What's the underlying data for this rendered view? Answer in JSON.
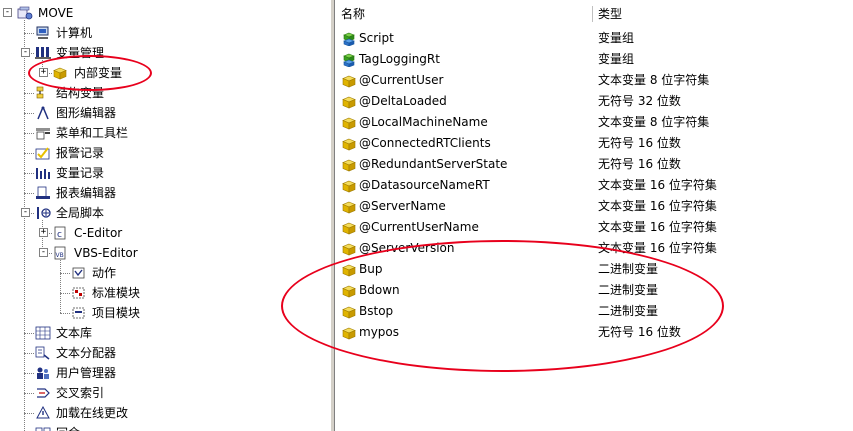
{
  "tree": {
    "items": [
      {
        "label": "MOVE",
        "level": 0,
        "icon": "computer-project-icon",
        "expander": "-"
      },
      {
        "label": "计算机",
        "level": 1,
        "icon": "computer-icon"
      },
      {
        "label": "变量管理",
        "level": 1,
        "icon": "tag-management-icon",
        "expander": "-"
      },
      {
        "label": "内部变量",
        "level": 2,
        "icon": "cube-group-icon",
        "expander": "+"
      },
      {
        "label": "结构变量",
        "level": 1,
        "icon": "structure-icon"
      },
      {
        "label": "图形编辑器",
        "level": 1,
        "icon": "graphics-editor-icon"
      },
      {
        "label": "菜单和工具栏",
        "level": 1,
        "icon": "menu-toolbar-icon"
      },
      {
        "label": "报警记录",
        "level": 1,
        "icon": "alarm-logging-icon"
      },
      {
        "label": "变量记录",
        "level": 1,
        "icon": "tag-logging-icon"
      },
      {
        "label": "报表编辑器",
        "level": 1,
        "icon": "report-editor-icon"
      },
      {
        "label": "全局脚本",
        "level": 1,
        "icon": "global-script-icon",
        "expander": "-"
      },
      {
        "label": "C-Editor",
        "level": 2,
        "icon": "c-editor-icon",
        "expander": "+"
      },
      {
        "label": "VBS-Editor",
        "level": 2,
        "icon": "vbs-editor-icon",
        "expander": "-"
      },
      {
        "label": "动作",
        "level": 3,
        "icon": "action-icon"
      },
      {
        "label": "标准模块",
        "level": 3,
        "icon": "standard-module-icon"
      },
      {
        "label": "项目模块",
        "level": 3,
        "icon": "project-module-icon"
      },
      {
        "label": "文本库",
        "level": 1,
        "icon": "text-library-icon"
      },
      {
        "label": "文本分配器",
        "level": 1,
        "icon": "text-distributor-icon"
      },
      {
        "label": "用户管理器",
        "level": 1,
        "icon": "user-admin-icon"
      },
      {
        "label": "交叉索引",
        "level": 1,
        "icon": "cross-reference-icon"
      },
      {
        "label": "加载在线更改",
        "level": 1,
        "icon": "load-online-changes-icon"
      },
      {
        "label": "冗余",
        "level": 1,
        "icon": "redundancy-icon"
      }
    ]
  },
  "list": {
    "columns": {
      "name": "名称",
      "type": "类型"
    },
    "rows": [
      {
        "name": "Script",
        "type": "变量组",
        "icon": "tag-group-icon"
      },
      {
        "name": "TagLoggingRt",
        "type": "变量组",
        "icon": "tag-group-icon"
      },
      {
        "name": "@CurrentUser",
        "type": "文本变量 8 位字符集",
        "icon": "tag-cube-icon"
      },
      {
        "name": "@DeltaLoaded",
        "type": "无符号 32 位数",
        "icon": "tag-cube-icon"
      },
      {
        "name": "@LocalMachineName",
        "type": "文本变量 8 位字符集",
        "icon": "tag-cube-icon"
      },
      {
        "name": "@ConnectedRTClients",
        "type": "无符号 16 位数",
        "icon": "tag-cube-icon"
      },
      {
        "name": "@RedundantServerState",
        "type": "无符号 16 位数",
        "icon": "tag-cube-icon"
      },
      {
        "name": "@DatasourceNameRT",
        "type": "文本变量 16 位字符集",
        "icon": "tag-cube-icon"
      },
      {
        "name": "@ServerName",
        "type": "文本变量 16 位字符集",
        "icon": "tag-cube-icon"
      },
      {
        "name": "@CurrentUserName",
        "type": "文本变量 16 位字符集",
        "icon": "tag-cube-icon"
      },
      {
        "name": "@ServerVersion",
        "type": "文本变量 16 位字符集",
        "icon": "tag-cube-icon"
      },
      {
        "name": "Bup",
        "type": "二进制变量",
        "icon": "tag-cube-icon"
      },
      {
        "name": "Bdown",
        "type": "二进制变量",
        "icon": "tag-cube-icon"
      },
      {
        "name": "Bstop",
        "type": "二进制变量",
        "icon": "tag-cube-icon"
      },
      {
        "name": "mypos",
        "type": "无符号 16 位数",
        "icon": "tag-cube-icon"
      }
    ]
  },
  "colors": {
    "annotation": "#e8001c",
    "cube": "#e0b400",
    "cube_dark": "#a07c00",
    "splitter": "#d4d0c8"
  }
}
